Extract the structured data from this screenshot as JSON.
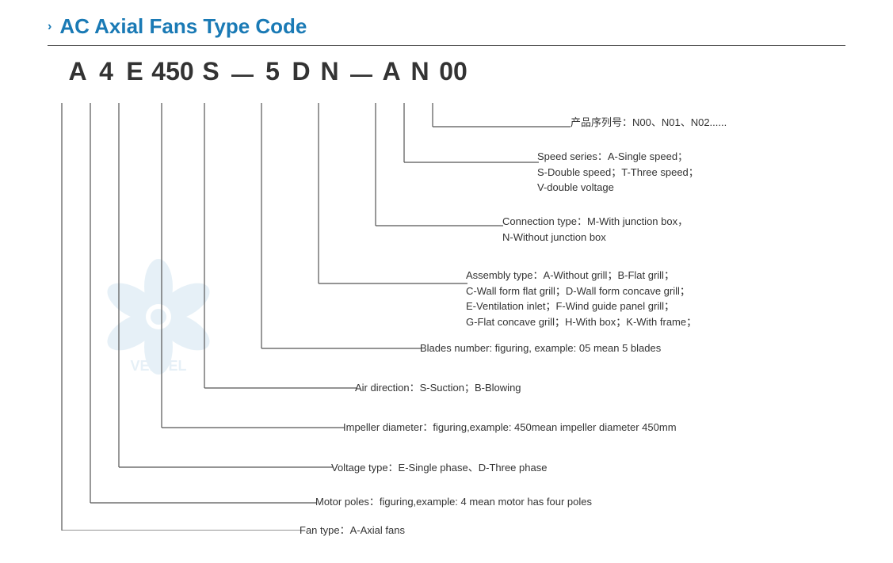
{
  "header": {
    "chevron": "›",
    "title": "AC Axial Fans Type Code"
  },
  "type_code": {
    "letters": [
      "A",
      "4",
      "E",
      "450",
      "S",
      "—",
      "5",
      "D",
      "N",
      "—",
      "A",
      "N",
      "00"
    ]
  },
  "annotations": {
    "product_series": {
      "label": "产品序列号：N00、N01、N02......"
    },
    "speed_series": {
      "label": "Speed series：A-Single speed；",
      "line2": "S-Double speed；T-Three speed；",
      "line3": "V-double voltage"
    },
    "connection_type": {
      "label": "Connection type：M-With junction box，",
      "line2": "N-Without junction box"
    },
    "assembly_type": {
      "label": "Assembly type：A-Without grill；B-Flat grill；",
      "line2": "C-Wall form flat grill；D-Wall form concave grill；",
      "line3": "E-Ventilation inlet；F-Wind guide panel grill；",
      "line4": "G-Flat concave grill；H-With box；K-With frame；"
    },
    "blades_number": {
      "label": "Blades number: figuring, example: 05 mean 5 blades"
    },
    "air_direction": {
      "label": "Air direction：S-Suction；B-Blowing"
    },
    "impeller_diameter": {
      "label": "Impeller diameter：figuring,example: 450mean impeller diameter 450mm"
    },
    "voltage_type": {
      "label": "Voltage type：E-Single phase、D-Three phase"
    },
    "motor_poles": {
      "label": "Motor poles：figuring,example: 4 mean motor has four poles"
    },
    "fan_type": {
      "label": "Fan type：A-Axial fans"
    }
  },
  "watermark": {
    "text": "VENTEL"
  }
}
